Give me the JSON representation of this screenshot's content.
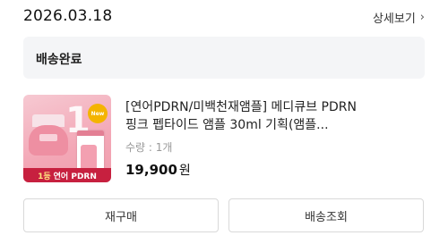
{
  "order": {
    "date": "2026.03.18",
    "detail_link": "상세보기",
    "status": "배송완료"
  },
  "product": {
    "name_line1": "[연어PDRN/미백천재앰플] 메디큐브 PDRN",
    "name_line2": "핑크 펩타이드 앰플 30ml 기획(앰플...",
    "quantity": "수량 : 1개",
    "price": "19,900",
    "price_unit": "원",
    "thumbnail": {
      "number": "1",
      "badge": "New",
      "banner_rank": "1등",
      "banner_text": "연어 PDRN",
      "colors": {
        "background": "#f3a7b6",
        "banner": "#c7203f"
      }
    }
  },
  "actions": {
    "rebuy": "재구매",
    "track": "배송조회"
  },
  "icons": {
    "detail_chevron": "chevron-right-icon"
  }
}
